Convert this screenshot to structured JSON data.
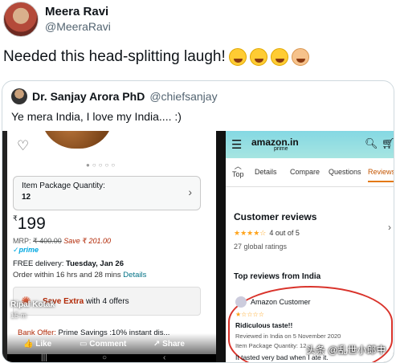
{
  "tweet": {
    "display_name": "Meera Ravi",
    "handle": "@MeeraRavi",
    "text": "Needed this head-splitting laugh!",
    "emojis": [
      "rofl-emoji",
      "rofl-emoji",
      "rofl-emoji",
      "facepalm-emoji"
    ]
  },
  "quoted": {
    "display_name": "Dr. Sanjay Arora PhD",
    "handle": "@chiefsanjay",
    "text": "Ye mera India, I love my India.... :)"
  },
  "left_screenshot": {
    "qty_label": "Item Package Quantity:",
    "qty_value": "12",
    "price_symbol": "₹",
    "price": "199",
    "mrp_label": "MRP:",
    "mrp_value": "₹ 400.00",
    "save_text": "Save ₹ 201.00",
    "prime": "✓prime",
    "delivery_prefix": "FREE delivery:",
    "delivery_date": "Tuesday, Jan 26",
    "order_within": "Order within 16 hrs and 28 mins",
    "details_link": "Details",
    "offers_red": "Save Extra",
    "offers_rest": "with 4 offers",
    "bank_offer_label": "Bank Offer:",
    "bank_offer_text": "Prime Savings :10% instant dis...",
    "overlay_user": "Ripal Kotak",
    "overlay_time": "15 m",
    "like": "Like",
    "comment": "Comment",
    "share": "Share"
  },
  "right_screenshot": {
    "logo": "amazon.in",
    "logo_sub": "prime",
    "tabs": [
      "Details",
      "Compare",
      "Questions",
      "Reviews"
    ],
    "top_label": "Top",
    "customer_reviews_title": "Customer reviews",
    "stars_display": "★★★★☆",
    "rating_text": "4 out of 5",
    "rating_value": 4,
    "global_ratings": "27 global ratings",
    "top_reviews_title": "Top reviews from India",
    "reviewer": "Amazon Customer",
    "review_stars": "★☆☆☆☆",
    "review_title": "Ridiculous taste!!",
    "review_meta": "Reviewed in India on 5 November 2020",
    "review_qty": "Item Package Quantity: 12",
    "review_body": "It tasted very bad when I ate it."
  },
  "watermark": "头条 @乱世小郎中",
  "colors": {
    "accent_tab": "#e47911",
    "prime_blue": "#00a8e1",
    "price_red": "#b12704",
    "circle_red": "#d9332b",
    "star": "#ffa41c"
  }
}
